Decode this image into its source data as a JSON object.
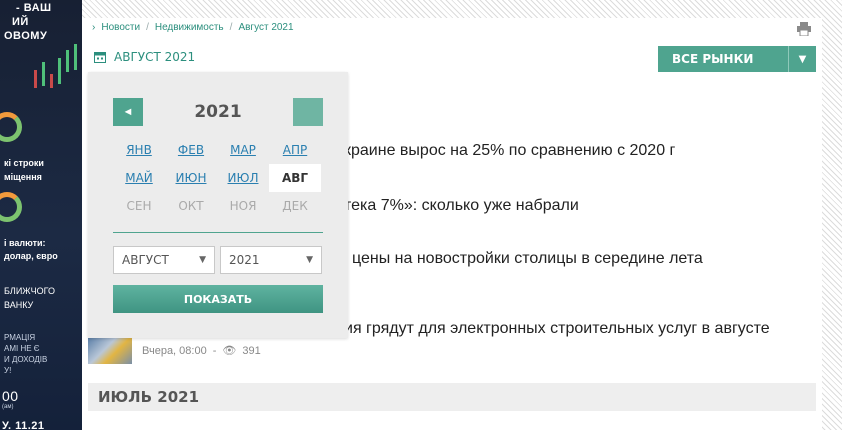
{
  "banner": {
    "lines": [
      "- ВАШ",
      "ИЙ",
      "ОВОМУ",
      "кі строки",
      "міщення",
      "і валюти:",
      "долар, євро",
      "БЛИЖЧОГО",
      "ВАНКУ",
      "РМАЦІЯ",
      "АМІ НЕ Є",
      "И ДОХОДІВ",
      "У!",
      "00",
      "(ам)",
      "У. 11.21"
    ]
  },
  "breadcrumb": {
    "items": [
      "Новости",
      "Недвижимость",
      "Август 2021"
    ]
  },
  "archive": {
    "month_label": "АВГУСТ 2021",
    "markets_button": "ВСЕ РЫНКИ"
  },
  "news": [
    {
      "title": "краине вырос на 25% по сравнению с 2020 г"
    },
    {
      "title": "тека 7%»: сколько уже набрали"
    },
    {
      "title": "цены на новостройки столицы в середине лета"
    },
    {
      "title": "ия грядут для электронных строительных услуг в августе"
    }
  ],
  "last_meta": {
    "time": "Вчера, 08:00",
    "dash": "-",
    "views": "391"
  },
  "july_label": "ИЮЛЬ 2021",
  "calendar": {
    "year": "2021",
    "prev": "◄",
    "months": [
      {
        "label": "ЯНВ",
        "state": "link"
      },
      {
        "label": "ФЕВ",
        "state": "link"
      },
      {
        "label": "МАР",
        "state": "link"
      },
      {
        "label": "АПР",
        "state": "link"
      },
      {
        "label": "МАЙ",
        "state": "link"
      },
      {
        "label": "ИЮН",
        "state": "link"
      },
      {
        "label": "ИЮЛ",
        "state": "link"
      },
      {
        "label": "АВГ",
        "state": "cur"
      },
      {
        "label": "СЕН",
        "state": "dis"
      },
      {
        "label": "ОКТ",
        "state": "dis"
      },
      {
        "label": "НОЯ",
        "state": "dis"
      },
      {
        "label": "ДЕК",
        "state": "dis"
      }
    ],
    "month_select": "АВГУСТ",
    "year_select": "2021",
    "show_button": "ПОКАЗАТЬ"
  },
  "colors": {
    "accent": "#4fa48f",
    "link": "#2a7fb0",
    "banner": "#172033"
  }
}
